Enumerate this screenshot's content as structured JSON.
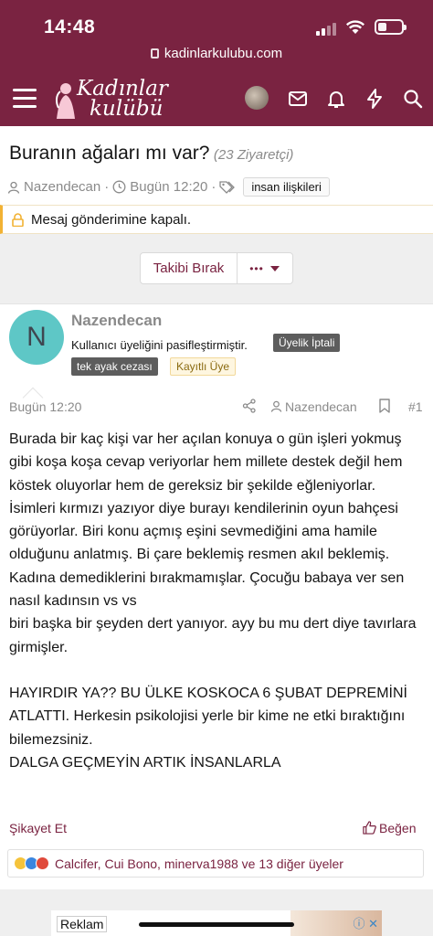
{
  "status_bar": {
    "time": "14:48"
  },
  "browser": {
    "url": "kadinlarkulubu.com"
  },
  "site": {
    "logo_line1": "Kadınlar",
    "logo_line2": "kulübü",
    "brand_color": "#7a2341"
  },
  "nav_icons": [
    "menu-icon",
    "avatar",
    "mail-icon",
    "bell-icon",
    "bolt-icon",
    "search-icon"
  ],
  "thread": {
    "title": "Buranın ağaları mı var?",
    "views": "(23 Ziyaretçi)",
    "author": "Nazendecan",
    "date": "Bugün 12:20",
    "tag": "insan ilişkileri",
    "locked_notice": "Mesaj gönderimine kapalı."
  },
  "actions": {
    "follow_label": "Takibi Bırak",
    "more_label": "•••"
  },
  "post": {
    "avatar_letter": "N",
    "username": "Nazendecan",
    "user_title": "Kullanıcı üyeliğini pasifleştirmiştir.",
    "badges": [
      "Üyelik İptali",
      "tek ayak cezası",
      "Kayıtlı Üye"
    ],
    "date": "Bugün 12:20",
    "author": "Nazendecan",
    "number": "#1",
    "paragraph1": "Burada bir kaç kişi var her açılan konuya o gün işleri yokmuş gibi koşa koşa cevap veriyorlar hem millete destek değil hem köstek oluyorlar hem de gereksiz bir şekilde eğleniyorlar. İsimleri kırmızı yazıyor diye burayı kendilerinin oyun bahçesi görüyorlar. Biri konu açmış eşini sevmediğini ama hamile olduğunu anlatmış. Bi çare beklemiş resmen akıl beklemiş. Kadına demediklerini bırakmamışlar. Çocuğu babaya ver sen nasıl kadınsın vs vs\nbiri başka bir şeyden dert yanıyor. ayy bu mu dert diye tavırlara girmişler.",
    "paragraph2": "HAYIRDIR YA?? BU ÜLKE KOSKOCA 6 ŞUBAT DEPREMİNİ ATLATTI. Herkesin psikolojisi yerle bir kime ne etki bıraktığını bilemezsiniz.\nDALGA GEÇMEYİN ARTIK İNSANLARLA",
    "report_label": "Şikayet Et",
    "like_label": "Beğen",
    "reactions_text": "Calcifer, Cui Bono, minerva1988 ve 13 diğer üyeler"
  },
  "ad": {
    "label": "Reklam"
  }
}
